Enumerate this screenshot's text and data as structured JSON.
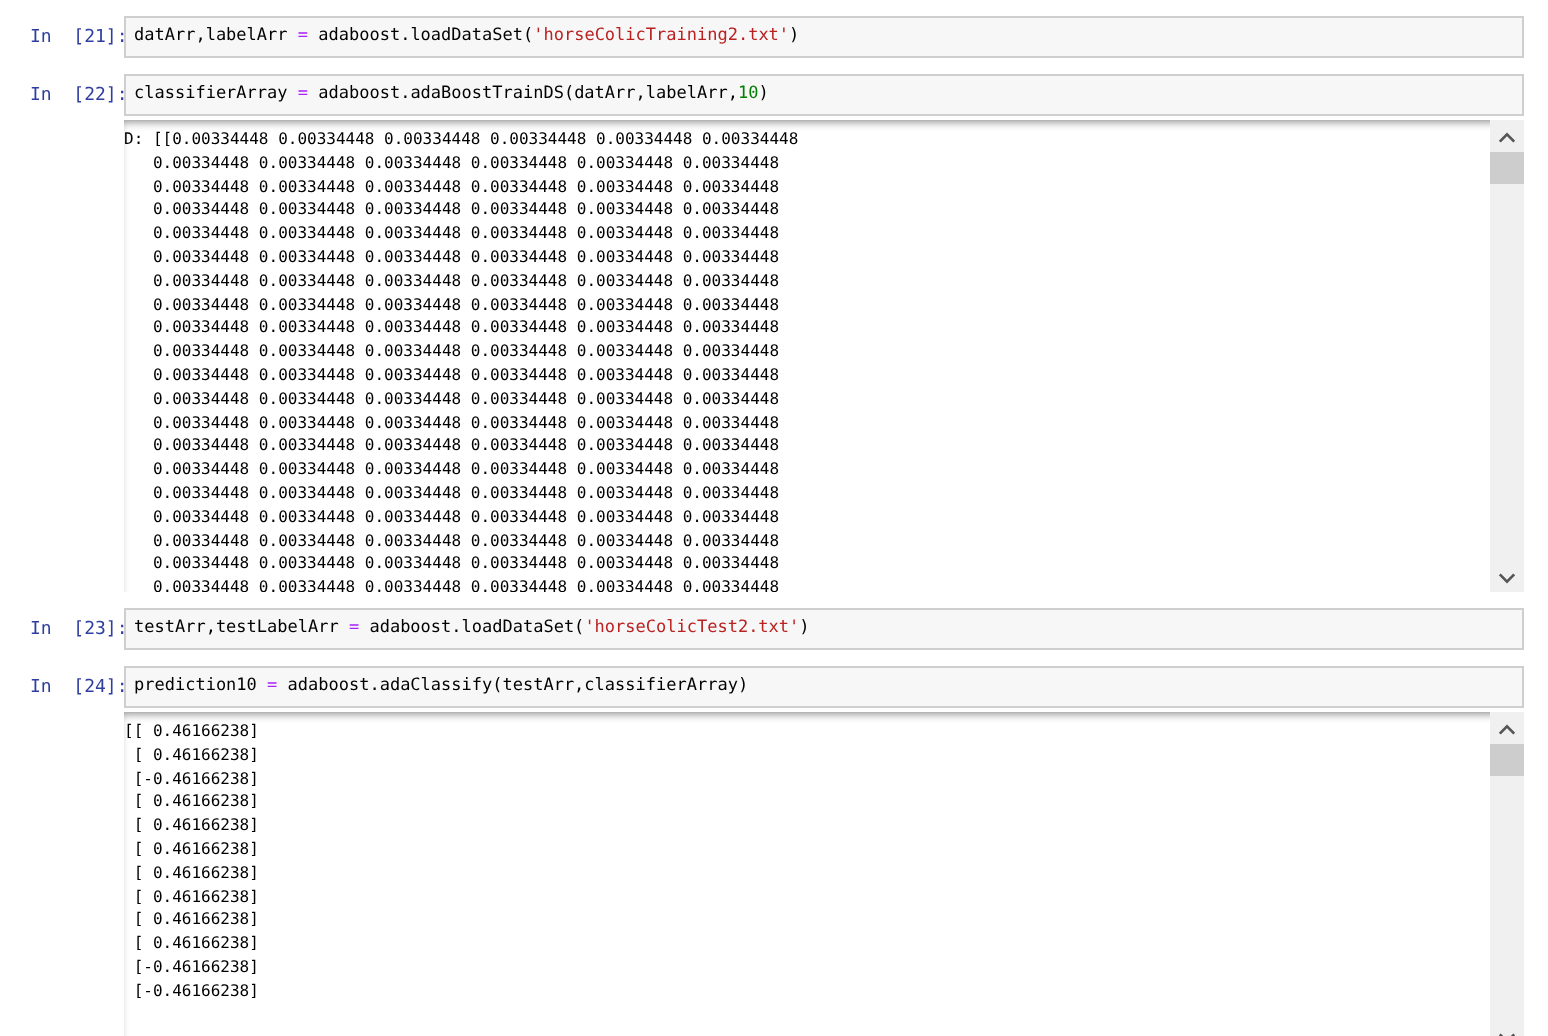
{
  "cells": [
    {
      "prompt": "In  [21]:",
      "code": [
        {
          "kind": "plain",
          "text": "datArr,labelArr "
        },
        {
          "kind": "op",
          "text": "="
        },
        {
          "kind": "plain",
          "text": " adaboost.loadDataSet("
        },
        {
          "kind": "string",
          "text": "'horseColicTraining2.txt'"
        },
        {
          "kind": "plain",
          "text": ")"
        }
      ]
    },
    {
      "prompt": "In  [22]:",
      "code": [
        {
          "kind": "plain",
          "text": "classifierArray "
        },
        {
          "kind": "op",
          "text": "="
        },
        {
          "kind": "plain",
          "text": " adaboost.adaBoostTrainDS(datArr,labelArr,"
        },
        {
          "kind": "number",
          "text": "10"
        },
        {
          "kind": "plain",
          "text": ")"
        }
      ],
      "output": {
        "lines": [
          "D: [[0.00334448 0.00334448 0.00334448 0.00334448 0.00334448 0.00334448",
          "   0.00334448 0.00334448 0.00334448 0.00334448 0.00334448 0.00334448",
          "   0.00334448 0.00334448 0.00334448 0.00334448 0.00334448 0.00334448",
          "   0.00334448 0.00334448 0.00334448 0.00334448 0.00334448 0.00334448",
          "   0.00334448 0.00334448 0.00334448 0.00334448 0.00334448 0.00334448",
          "   0.00334448 0.00334448 0.00334448 0.00334448 0.00334448 0.00334448",
          "   0.00334448 0.00334448 0.00334448 0.00334448 0.00334448 0.00334448",
          "   0.00334448 0.00334448 0.00334448 0.00334448 0.00334448 0.00334448",
          "   0.00334448 0.00334448 0.00334448 0.00334448 0.00334448 0.00334448",
          "   0.00334448 0.00334448 0.00334448 0.00334448 0.00334448 0.00334448",
          "   0.00334448 0.00334448 0.00334448 0.00334448 0.00334448 0.00334448",
          "   0.00334448 0.00334448 0.00334448 0.00334448 0.00334448 0.00334448",
          "   0.00334448 0.00334448 0.00334448 0.00334448 0.00334448 0.00334448",
          "   0.00334448 0.00334448 0.00334448 0.00334448 0.00334448 0.00334448",
          "   0.00334448 0.00334448 0.00334448 0.00334448 0.00334448 0.00334448",
          "   0.00334448 0.00334448 0.00334448 0.00334448 0.00334448 0.00334448",
          "   0.00334448 0.00334448 0.00334448 0.00334448 0.00334448 0.00334448",
          "   0.00334448 0.00334448 0.00334448 0.00334448 0.00334448 0.00334448",
          "   0.00334448 0.00334448 0.00334448 0.00334448 0.00334448 0.00334448",
          "   0.00334448 0.00334448 0.00334448 0.00334448 0.00334448 0.00334448"
        ]
      }
    },
    {
      "prompt": "In  [23]:",
      "code": [
        {
          "kind": "plain",
          "text": "testArr,testLabelArr "
        },
        {
          "kind": "op",
          "text": "="
        },
        {
          "kind": "plain",
          "text": " adaboost.loadDataSet("
        },
        {
          "kind": "string",
          "text": "'horseColicTest2.txt'"
        },
        {
          "kind": "plain",
          "text": ")"
        }
      ]
    },
    {
      "prompt": "In  [24]:",
      "code": [
        {
          "kind": "plain",
          "text": "prediction10 "
        },
        {
          "kind": "op",
          "text": "="
        },
        {
          "kind": "plain",
          "text": " adaboost.adaClassify(testArr,classifierArray)"
        }
      ],
      "output": {
        "lines": [
          "[[ 0.46166238]",
          " [ 0.46166238]",
          " [-0.46166238]",
          " [ 0.46166238]",
          " [ 0.46166238]",
          " [ 0.46166238]",
          " [ 0.46166238]",
          " [ 0.46166238]",
          " [ 0.46166238]",
          " [ 0.46166238]",
          " [-0.46166238]",
          " [-0.46166238]"
        ]
      }
    }
  ]
}
